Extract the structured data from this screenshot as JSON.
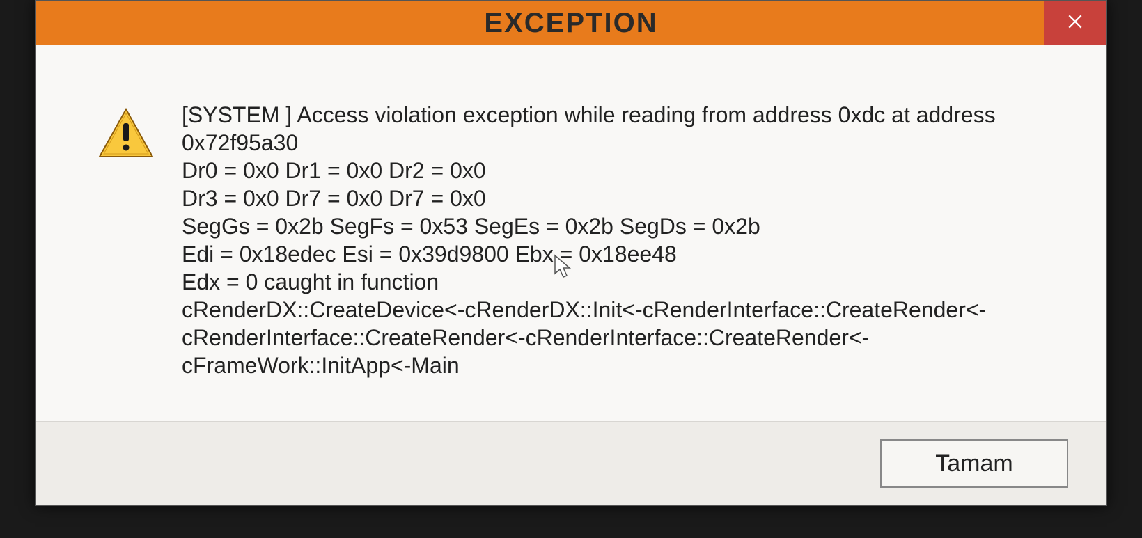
{
  "dialog": {
    "title": "EXCEPTION",
    "close_label": "Close",
    "ok_label": "Tamam",
    "message_lines": [
      "[SYSTEM  ] Access violation exception while reading from address 0xdc at address 0x72f95a30",
      "Dr0 = 0x0  Dr1 = 0x0  Dr2 = 0x0",
      "Dr3 = 0x0  Dr7 = 0x0  Dr7 = 0x0",
      "SegGs = 0x2b  SegFs = 0x53  SegEs = 0x2b  SegDs = 0x2b",
      "Edi = 0x18edec  Esi = 0x39d9800  Ebx = 0x18ee48",
      "Edx = 0 caught in function",
      "cRenderDX::CreateDevice<-cRenderDX::Init<-cRenderInterface::CreateRender<-cRenderInterface::CreateRender<-cRenderInterface::CreateRender<-cFrameWork::InitApp<-Main"
    ]
  },
  "colors": {
    "titlebar": "#e87b1c",
    "close": "#c8413b"
  }
}
